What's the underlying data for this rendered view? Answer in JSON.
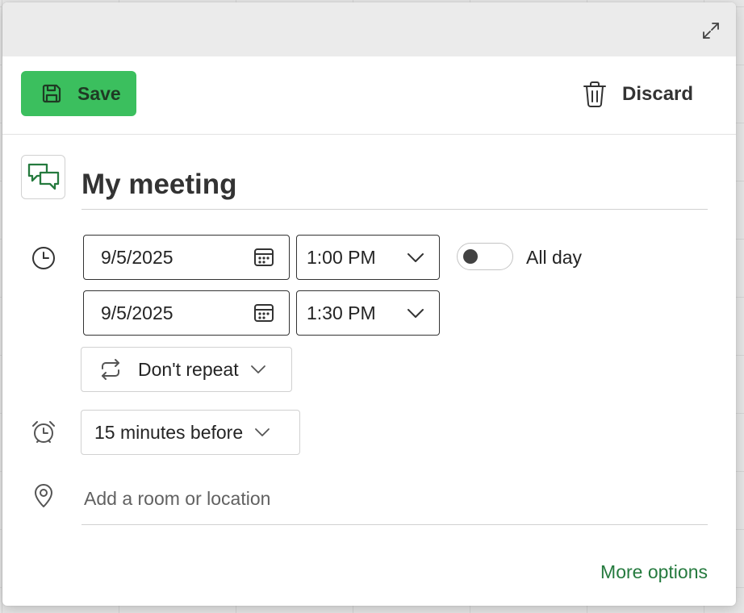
{
  "toolbar": {
    "save_label": "Save",
    "discard_label": "Discard"
  },
  "event": {
    "title": "My meeting",
    "start_date": "9/5/2025",
    "start_time": "1:00 PM",
    "end_date": "9/5/2025",
    "end_time": "1:30 PM",
    "all_day_label": "All day",
    "all_day_on": false,
    "repeat": "Don't repeat",
    "reminder": "15 minutes before",
    "location_placeholder": "Add a room or location"
  },
  "footer": {
    "more_options_label": "More options"
  },
  "background": {
    "ghost_text": "e"
  },
  "colors": {
    "save_button": "#3bbf5e",
    "accent_green": "#257a3e",
    "panel_bg": "#ffffff",
    "titlebar_bg": "#ebebeb"
  },
  "icons": {
    "expand": "expand-icon",
    "save": "save-icon",
    "discard": "trash-icon",
    "event_type": "chat-bubbles-icon",
    "time": "clock-icon",
    "calendar": "calendar-icon",
    "dropdown": "chevron-down-icon",
    "repeat": "repeat-icon",
    "reminder": "alarm-clock-icon",
    "location": "location-pin-icon"
  }
}
